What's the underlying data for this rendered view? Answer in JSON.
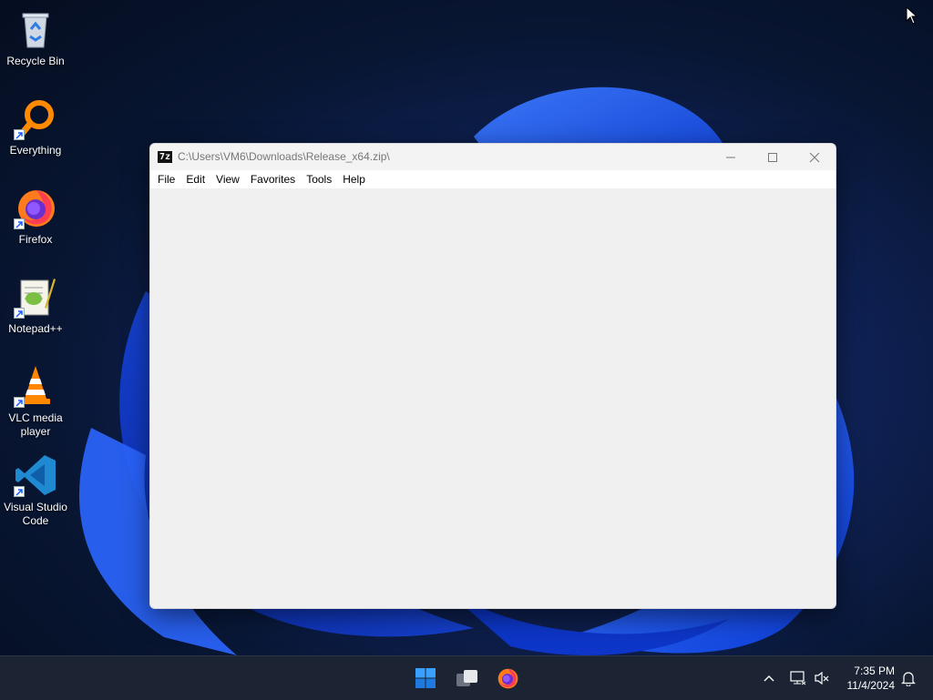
{
  "desktop": {
    "icons": [
      {
        "label": "Recycle Bin",
        "icon": "recycle-bin-icon"
      },
      {
        "label": "Everything",
        "icon": "everything-search-icon"
      },
      {
        "label": "Firefox",
        "icon": "firefox-icon"
      },
      {
        "label": "Notepad++",
        "icon": "notepadpp-icon"
      },
      {
        "label": "VLC media player",
        "icon": "vlc-icon"
      },
      {
        "label": "Visual Studio Code",
        "icon": "vscode-icon"
      }
    ]
  },
  "window": {
    "app_icon_text": "7z",
    "title": "C:\\Users\\VM6\\Downloads\\Release_x64.zip\\",
    "menu": [
      "File",
      "Edit",
      "View",
      "Favorites",
      "Tools",
      "Help"
    ]
  },
  "taskbar": {
    "apps": [
      "start-icon",
      "task-view-icon",
      "firefox-icon"
    ],
    "tray": [
      "chevron-up-icon",
      "network-icon",
      "volume-muted-icon",
      "notification-bell-icon"
    ],
    "time": "7:35 PM",
    "date": "11/4/2024"
  },
  "colors": {
    "accent": "#1a5cff",
    "taskbar": "#1c2434",
    "window_bg": "#f0f0f0"
  }
}
